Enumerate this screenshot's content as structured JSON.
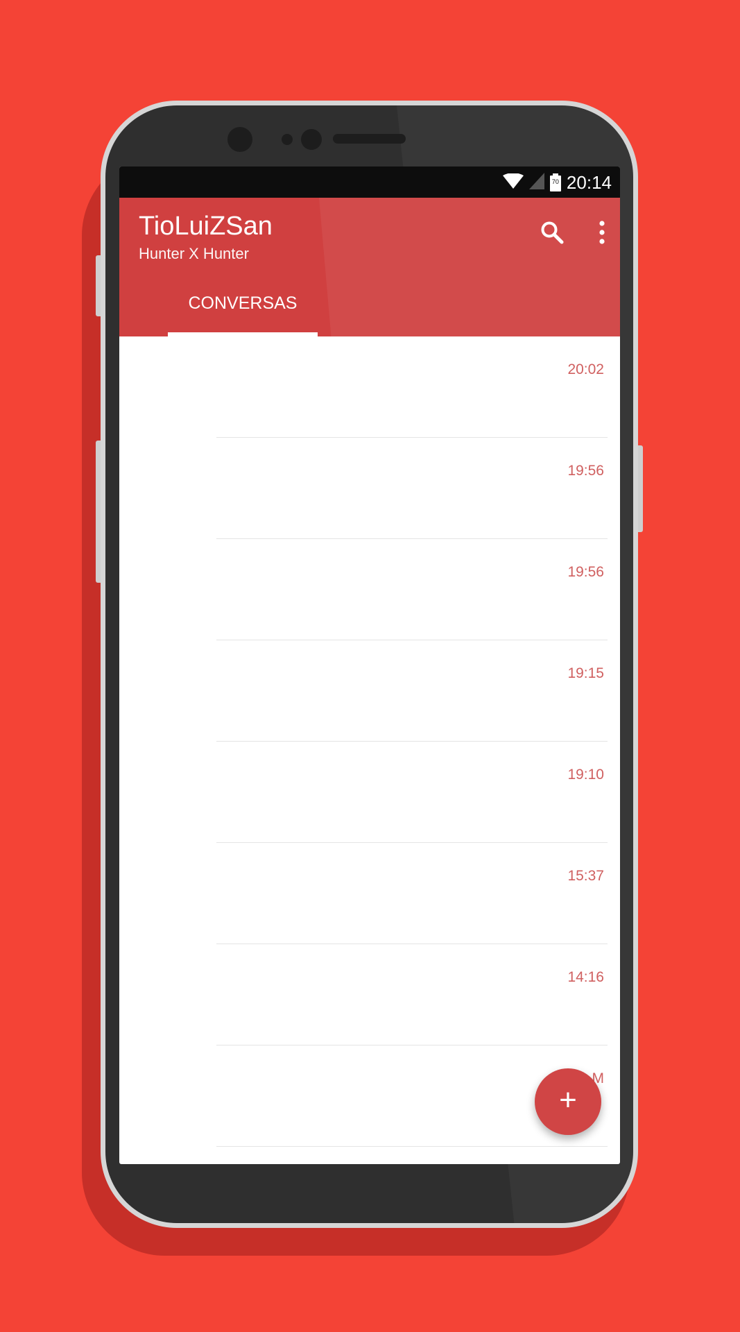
{
  "status_bar": {
    "time": "20:14",
    "battery_level_text": "70"
  },
  "app_bar": {
    "title": "TioLuiZSan",
    "subtitle": "Hunter X Hunter",
    "actions": [
      "search-icon",
      "more-vert-icon"
    ]
  },
  "tabs": [
    {
      "label": "CONVERSAS",
      "selected": true
    }
  ],
  "conversations": [
    {
      "time": "20:02"
    },
    {
      "time": "19:56"
    },
    {
      "time": "19:56"
    },
    {
      "time": "19:15"
    },
    {
      "time": "19:10"
    },
    {
      "time": "15:37"
    },
    {
      "time": "14:16"
    },
    {
      "time": "M"
    }
  ],
  "fab": {
    "label": "+"
  },
  "colors": {
    "background": "#f44336",
    "app_bar": "#d04040",
    "accent": "#d04545",
    "time_text": "#d06060",
    "status_bar": "#0d0d0d"
  }
}
